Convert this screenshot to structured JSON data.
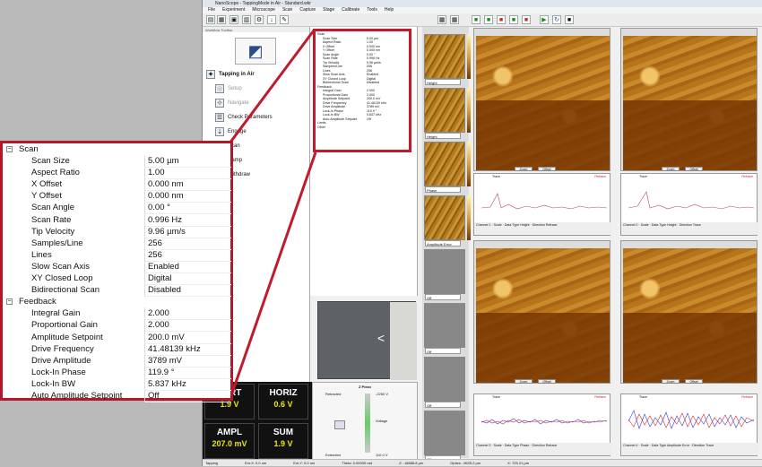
{
  "app": {
    "title": "NanoScope - TappingMode in Air - Standard.wkr",
    "menus": [
      "File",
      "Experiment",
      "Microscope",
      "Scan",
      "Capture",
      "Stage",
      "Calibrate",
      "Tools",
      "Help"
    ]
  },
  "workflow": {
    "toolbar_label": "Workflow Toolbar",
    "mode": "Tapping in Air",
    "items": [
      "Setup",
      "Navigate",
      "Check Parameters",
      "Engage",
      "Scan",
      "Ramp",
      "Withdraw"
    ]
  },
  "params": {
    "groups": [
      {
        "name": "Scan",
        "rows": [
          {
            "k": "Scan Size",
            "v": "5.00 µm"
          },
          {
            "k": "Aspect Ratio",
            "v": "1.00"
          },
          {
            "k": "X Offset",
            "v": "0.000 nm"
          },
          {
            "k": "Y Offset",
            "v": "0.000 nm"
          },
          {
            "k": "Scan Angle",
            "v": "0.00 °"
          },
          {
            "k": "Scan Rate",
            "v": "0.996 Hz"
          },
          {
            "k": "Tip Velocity",
            "v": "9.96 µm/s"
          },
          {
            "k": "Samples/Line",
            "v": "256"
          },
          {
            "k": "Lines",
            "v": "256"
          },
          {
            "k": "Slow Scan Axis",
            "v": "Enabled"
          },
          {
            "k": "XY Closed Loop",
            "v": "Digital"
          },
          {
            "k": "Bidirectional Scan",
            "v": "Disabled"
          }
        ]
      },
      {
        "name": "Feedback",
        "rows": [
          {
            "k": "Integral Gain",
            "v": "2.000"
          },
          {
            "k": "Proportional Gain",
            "v": "2.000"
          },
          {
            "k": "Amplitude Setpoint",
            "v": "200.0 mV"
          },
          {
            "k": "Drive Frequency",
            "v": "41.48139 kHz"
          },
          {
            "k": "Drive Amplitude",
            "v": "3789 mV"
          },
          {
            "k": "Lock-In Phase",
            "v": "119.9 °"
          },
          {
            "k": "Lock-In BW",
            "v": "5.837 kHz"
          },
          {
            "k": "Auto Amplitude Setpoint",
            "v": "Off"
          }
        ]
      }
    ],
    "extra_groups": [
      "Limits",
      "Other"
    ]
  },
  "meters": {
    "vert": {
      "label": "VERT",
      "value": "1.9 V"
    },
    "horiz": {
      "label": "HORIZ",
      "value": "0.6 V"
    },
    "ampl": {
      "label": "AMPL",
      "value": "207.0 mV"
    },
    "sum": {
      "label": "SUM",
      "value": "1.9 V"
    }
  },
  "zpiezo": {
    "title": "Z Piezo",
    "retracted": "Retracted",
    "extended": "Extended",
    "top": "-2250 V",
    "voltage": "Voltage",
    "bottom": "110.0 V"
  },
  "thumbs": [
    "Height",
    "Height",
    "Phase",
    "Amplitude Error",
    "Off",
    "Off",
    "Off",
    "Off"
  ],
  "panels": [
    {
      "channel": "1",
      "datatype": "Height",
      "direction": "Retrace"
    },
    {
      "channel": "2",
      "datatype": "Height",
      "direction": "Trace"
    },
    {
      "channel": "3",
      "datatype": "Phase",
      "direction": "Retrace"
    },
    {
      "channel": "4",
      "datatype": "Amplitude Error",
      "direction": "Trace"
    }
  ],
  "buttons": {
    "zoom": "Zoom",
    "offset": "Offset"
  },
  "profile": {
    "trace": "Trace",
    "retrace": "Retrace",
    "channel": "Channel",
    "scale": "Scale",
    "data_type": "Data Type",
    "direction": "Direction",
    "center": "Center"
  },
  "status": [
    "Tapping",
    "Em:X: 0.0 um",
    "Em:Y: 0.0 um",
    "Theta: 0.00000 rad",
    "Z: -18888.8 µm",
    "Optics: -9625.2 µm",
    "X: 725.21 µm",
    "Y: 151353.8 µm"
  ],
  "colors": {
    "callout": "#c01a2c",
    "meter_value": "#e6e61a"
  }
}
